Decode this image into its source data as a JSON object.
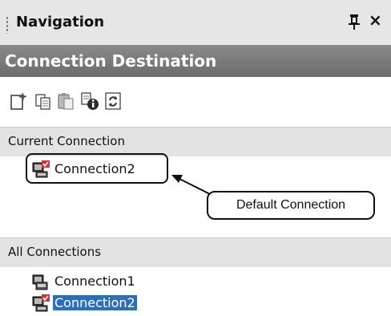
{
  "panel": {
    "title": "Navigation",
    "pin_icon": "pin-icon",
    "close_glyph": "×"
  },
  "section": {
    "title": "Connection Destination"
  },
  "toolbar": {
    "buttons": [
      "new-connection-icon",
      "copy-icon",
      "paste-icon",
      "properties-icon",
      "refresh-icon"
    ]
  },
  "current_connection": {
    "header": "Current Connection",
    "items": [
      {
        "label": "Connection2",
        "icon": "connection-default-icon"
      }
    ]
  },
  "all_connections": {
    "header": "All Connections",
    "items": [
      {
        "label": "Connection1",
        "icon": "connection-icon"
      },
      {
        "label": "Connection2",
        "icon": "connection-default-icon",
        "selected": true
      }
    ]
  },
  "annotation": {
    "label": "Default Connection"
  },
  "colors": {
    "selection": "#2a6fb8",
    "header_bg": "#7b7b7b",
    "group_bg": "#e3e3e3"
  }
}
